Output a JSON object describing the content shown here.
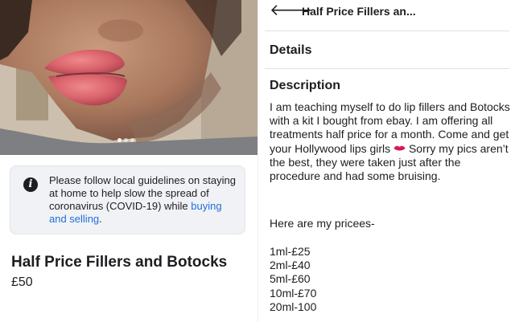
{
  "listing": {
    "carousel_dots": 3,
    "notice": {
      "text": "Please follow local guidelines on staying at home to help slow the spread of coronavirus (COVID-19) while ",
      "link": "buying and selling",
      "end": "."
    },
    "title": "Half Price Fillers and Botocks",
    "price": "£50"
  },
  "detail": {
    "header_title": "Half Price Fillers an...",
    "back_icon": "back-arrow-icon",
    "details_heading": "Details",
    "description_heading": "Description",
    "description_part1": "I am teaching myself to do lip fillers and Botocks with a kit I bought from ebay. I am offering all treatments half price for a month. Come and get your Hollywood lips girls",
    "lips_icon": "lips-emoji-icon",
    "description_part2": " Sorry my pics aren’t the best, they were taken just after the procedure and had some bruising.",
    "prices_intro": "Here are my pricees-",
    "prices": [
      "1ml-£25",
      "2ml-£40",
      "5ml-£60",
      "10ml-£70",
      "20ml-100"
    ]
  },
  "colors": {
    "link": "#216fdb",
    "notice_bg": "#f0f2f5",
    "lips": "#e0245e"
  }
}
